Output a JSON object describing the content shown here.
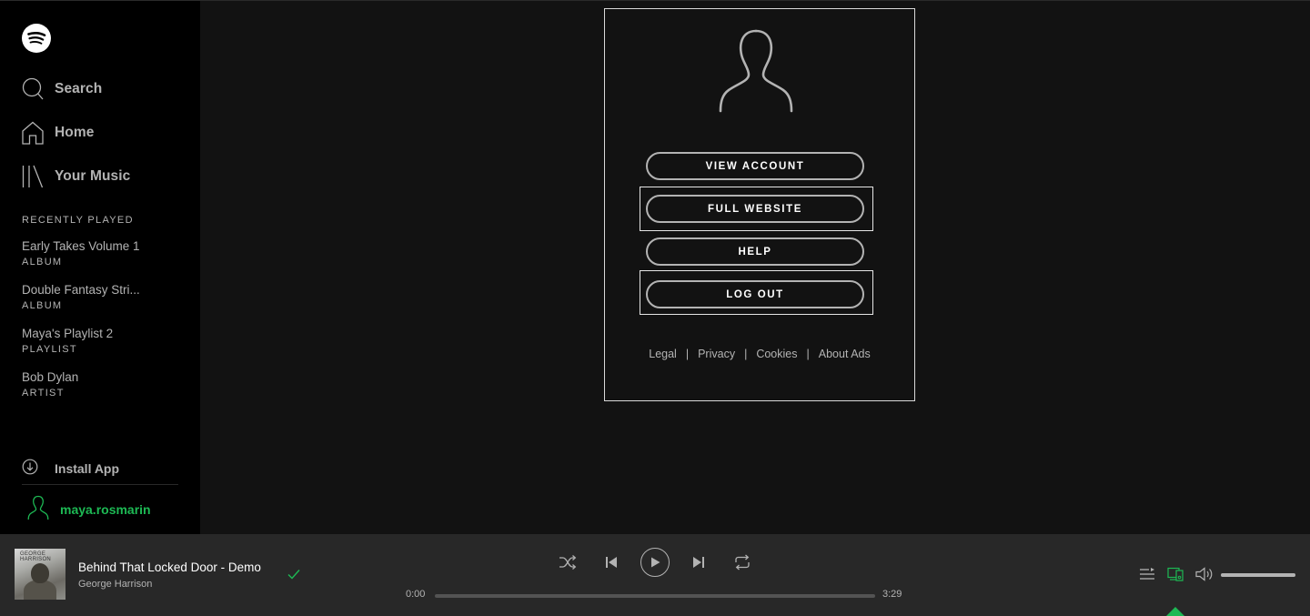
{
  "sidebar": {
    "nav": [
      {
        "label": "Search",
        "icon": "search-icon"
      },
      {
        "label": "Home",
        "icon": "home-icon"
      },
      {
        "label": "Your Music",
        "icon": "library-icon"
      }
    ],
    "recent_heading": "RECENTLY PLAYED",
    "recent": [
      {
        "title": "Early Takes Volume 1",
        "type": "ALBUM"
      },
      {
        "title": "Double Fantasy Stri...",
        "type": "ALBUM"
      },
      {
        "title": "Maya's Playlist 2",
        "type": "PLAYLIST"
      },
      {
        "title": "Bob Dylan",
        "type": "ARTIST"
      }
    ],
    "install_app": "Install App",
    "username": "maya.rosmarin"
  },
  "account_menu": {
    "buttons": {
      "view_account": "VIEW ACCOUNT",
      "full_website": "FULL WEBSITE",
      "help": "HELP",
      "log_out": "LOG OUT"
    },
    "footer_links": [
      "Legal",
      "Privacy",
      "Cookies",
      "About Ads"
    ],
    "separator": "|"
  },
  "player": {
    "track_title": "Behind That Locked Door - Demo",
    "artist": "George Harrison",
    "cover_text": "GEORGE HARRISON",
    "time_current": "0:00",
    "time_total": "3:29",
    "progress_fraction": 0.0,
    "volume_fraction": 1.0
  },
  "colors": {
    "accent_green": "#1db954",
    "sidebar_bg": "#000000",
    "main_bg": "#121212",
    "player_bg": "#282828",
    "text_muted": "#b3b3b3"
  }
}
